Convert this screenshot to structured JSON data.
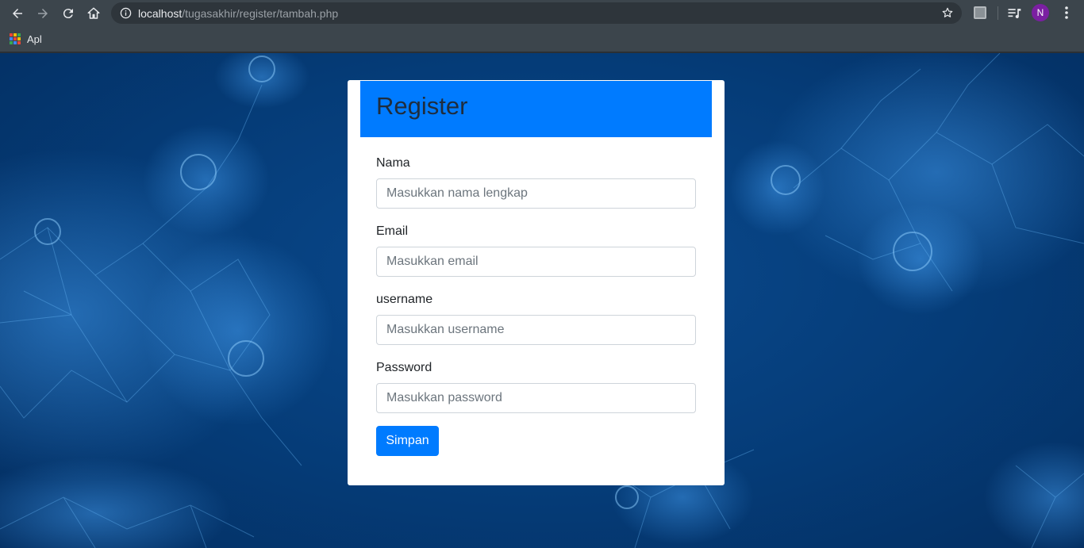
{
  "browser": {
    "url_host": "localhost",
    "url_path": "/tugasakhir/register/tambah.php",
    "profile_initial": "N",
    "profile_color": "#7b1fa2",
    "bookmarks": [
      {
        "label": "Apl",
        "icon": "apps-grid-icon"
      }
    ]
  },
  "page": {
    "title": "Register",
    "header_color": "#007bff",
    "fields": [
      {
        "label": "Nama",
        "placeholder": "Masukkan nama lengkap",
        "value": ""
      },
      {
        "label": "Email",
        "placeholder": "Masukkan email",
        "value": ""
      },
      {
        "label": "username",
        "placeholder": "Masukkan username",
        "value": ""
      },
      {
        "label": "Password",
        "placeholder": "Masukkan password",
        "value": ""
      }
    ],
    "submit_label": "Simpan",
    "accent_color": "#007bff"
  }
}
